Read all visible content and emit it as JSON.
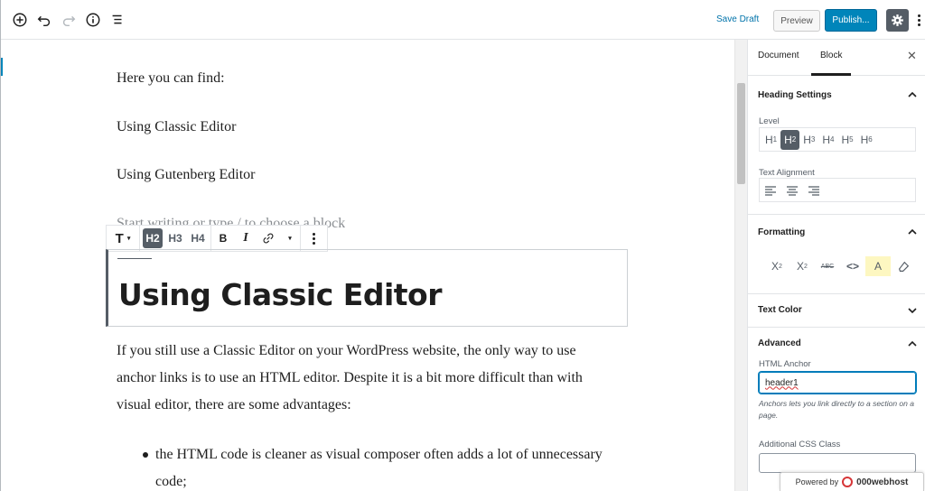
{
  "topbar": {
    "save_draft": "Save Draft",
    "preview": "Preview",
    "publish": "Publish..."
  },
  "editor": {
    "paragraphs": [
      "Here you can find:",
      "Using Classic Editor",
      "Using Gutenberg Editor"
    ],
    "placeholder": "Start writing or type / to choose a block",
    "block_toolbar": {
      "transform": "T",
      "h2": "H2",
      "h3": "H3",
      "h4": "H4",
      "bold": "B",
      "italic": "I"
    },
    "heading": "Using Classic Editor",
    "body": "If you still use a Classic Editor on your WordPress website, the only way to use anchor links is to use an HTML editor. Despite it is a bit more difficult than with visual editor, there are some advantages:",
    "bullet": "the HTML code is cleaner as visual composer often adds a lot of unnecessary code;"
  },
  "sidebar": {
    "tabs": [
      "Document",
      "Block"
    ],
    "active_tab": "Block",
    "heading_settings": {
      "title": "Heading Settings",
      "level_label": "Level",
      "levels": [
        "H1",
        "H2",
        "H3",
        "H4",
        "H5",
        "H6"
      ],
      "active_level": "H2",
      "alignment_label": "Text Alignment"
    },
    "formatting": {
      "title": "Formatting"
    },
    "text_color": {
      "title": "Text Color"
    },
    "advanced": {
      "title": "Advanced",
      "anchor_label": "HTML Anchor",
      "anchor_value": "header1",
      "help": "Anchors lets you link directly to a section on a page.",
      "css_label": "Additional CSS Class"
    }
  },
  "powered": {
    "prefix": "Powered by",
    "brand": "000webhost"
  },
  "colors": {
    "accent": "#0085ba",
    "dark": "#555d66",
    "highlight": "#fdf7c1"
  }
}
